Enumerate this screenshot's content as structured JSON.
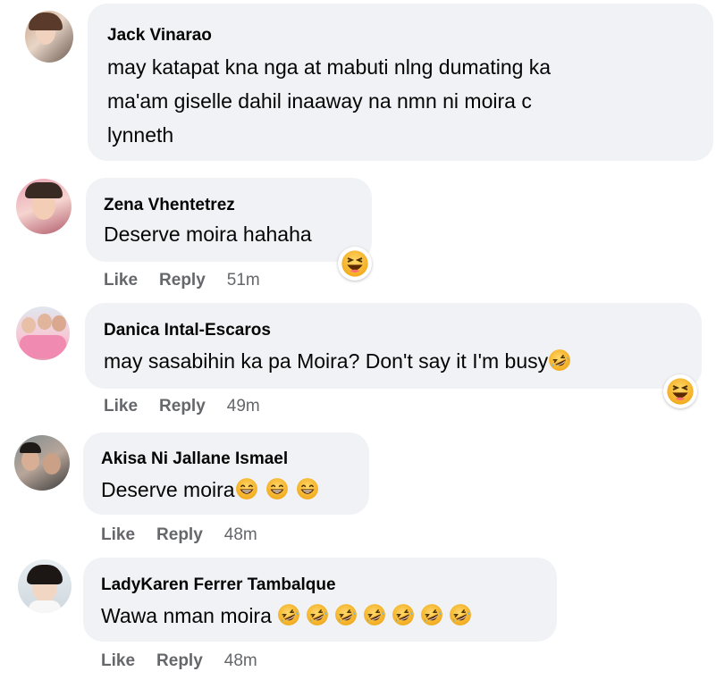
{
  "comments": [
    {
      "name": "Jack Vinarao",
      "lines": [
        "may katapat kna nga at mabuti nlng dumating ka",
        "ma'am giselle dahil inaaway na nmn ni moira c",
        "lynneth"
      ],
      "like": "",
      "reply": "",
      "time": ""
    },
    {
      "name": "Zena Vhentetrez",
      "lines": [
        "Deserve moira hahaha"
      ],
      "like": "Like",
      "reply": "Reply",
      "time": "51m",
      "reaction_icon": "laughing-face-icon"
    },
    {
      "name": "Danica Intal-Escaros",
      "lines": [
        "may sasabihin ka pa Moira? Don't say it I'm busy"
      ],
      "trailing_emoji": "rolling-laughing-icon",
      "like": "Like",
      "reply": "Reply",
      "time": "49m",
      "reaction_icon": "laughing-face-icon"
    },
    {
      "name": "Akisa Ni Jallane Ismael",
      "lines": [
        "Deserve moira"
      ],
      "trailing_emoji": "grinning-squint-icon",
      "trailing_emoji_count": 3,
      "like": "Like",
      "reply": "Reply",
      "time": "48m"
    },
    {
      "name": "LadyKaren Ferrer Tambalque",
      "lines": [
        "Wawa nman moira "
      ],
      "trailing_emoji": "rolling-laughing-icon",
      "trailing_emoji_count": 7,
      "like": "Like",
      "reply": "Reply",
      "time": "48m"
    }
  ],
  "colors": {
    "bubble": "#f0f2f5",
    "meta": "#65676b",
    "text": "#050505",
    "emoji_yellow": "#f7b928"
  }
}
